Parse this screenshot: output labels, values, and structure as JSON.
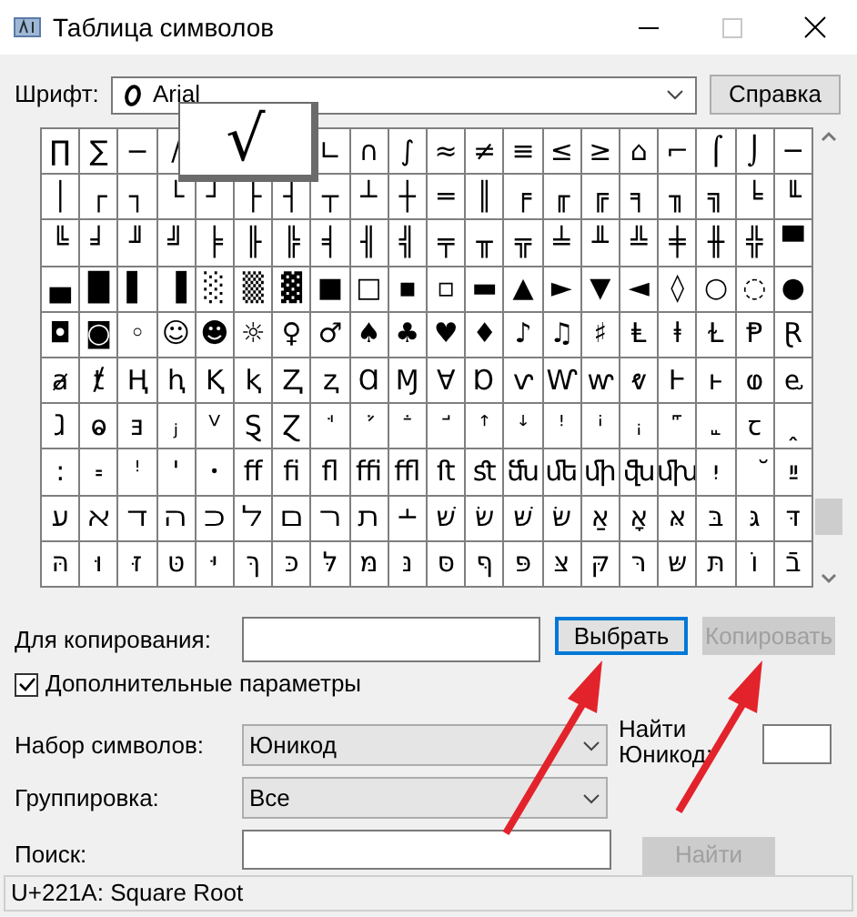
{
  "window": {
    "title": "Таблица символов"
  },
  "font": {
    "label": "Шрифт:",
    "value": "Arial"
  },
  "help_button": {
    "label": "Справка"
  },
  "grid": {
    "magnifier": "√",
    "rows": [
      [
        "∏",
        "∑",
        "−",
        "∕",
        null,
        null,
        null,
        "∟",
        "∩",
        "∫",
        "≈",
        "≠",
        "≡",
        "≤",
        "≥",
        "⌂",
        "⌐",
        "⌠",
        "⌡",
        "─"
      ],
      [
        "│",
        "┌",
        "┐",
        "└",
        "┘",
        "├",
        "┤",
        "┬",
        "┴",
        "┼",
        "═",
        "║",
        "╒",
        "╓",
        "╔",
        "╕",
        "╖",
        "╗",
        "╘",
        "╙"
      ],
      [
        "╚",
        "╛",
        "╜",
        "╝",
        "╞",
        "╟",
        "╠",
        "╡",
        "╢",
        "╣",
        "╤",
        "╥",
        "╦",
        "╧",
        "╨",
        "╩",
        "╪",
        "╫",
        "╬",
        "▀"
      ],
      [
        "▄",
        "█",
        "▌",
        "▐",
        "░",
        "▒",
        "▓",
        "■",
        "□",
        "▪",
        "▫",
        "▬",
        "▲",
        "►",
        "▼",
        "◄",
        "◊",
        "○",
        "◌",
        "●"
      ],
      [
        "◘",
        "◙",
        "◦",
        "☺",
        "☻",
        "☼",
        "♀",
        "♂",
        "♠",
        "♣",
        "♥",
        "♦",
        "♪",
        "♫",
        "♯",
        "Ⱡ",
        "ⱡ",
        "Ɫ",
        "Ᵽ",
        "Ɽ"
      ],
      [
        "ⱥ",
        "ⱦ",
        "Ⱨ",
        "ⱨ",
        "Ⱪ",
        "ⱪ",
        "Ⱬ",
        "ⱬ",
        "Ɑ",
        "Ɱ",
        "Ɐ",
        "Ɒ",
        "ⱱ",
        "Ⱳ",
        "ⱳ",
        "ⱴ",
        "Ⱶ",
        "ⱶ",
        "ⱷ",
        "ⱸ"
      ],
      [
        "ⱹ",
        "ⱺ",
        "ⱻ",
        "ⱼ",
        "ⱽ",
        "Ȿ",
        "Ɀ",
        "ꜗ",
        "ꜘ",
        "ꜙ",
        "ꜚ",
        "ꜛ",
        "ꜜ",
        "ꜝ",
        "ꜞ",
        "ꜟ",
        "꜠",
        "꜡",
        "ꞇ",
        "ꞈ"
      ],
      [
        "꞉",
        "꞊",
        "ꜝ",
        "ꞌ",
        "ꞏ",
        "ﬀ",
        "ﬁ",
        "ﬂ",
        "ﬃ",
        "ﬄ",
        "ﬅ",
        "ﬆ",
        "ﬓ",
        "ﬔ",
        "ﬕ",
        "ﬖ",
        "ﬗ",
        "יִ",
        "ﬞ",
        "ײַ"
      ],
      [
        "ﬠ",
        "ﬡ",
        "ﬢ",
        "ﬣ",
        "ﬤ",
        "ﬥ",
        "ﬦ",
        "ﬧ",
        "ﬨ",
        "﬩",
        "שׁ",
        "שׂ",
        "שּׁ",
        "שּׂ",
        "אַ",
        "אָ",
        "אּ",
        "בּ",
        "גּ",
        "דּ"
      ],
      [
        "הּ",
        "וּ",
        "זּ",
        "טּ",
        "יּ",
        "ךּ",
        "כּ",
        "לּ",
        "מּ",
        "נּ",
        "סּ",
        "ףּ",
        "פּ",
        "צּ",
        "קּ",
        "רּ",
        "שּ",
        "תּ",
        "וֹ",
        "בֿ"
      ]
    ]
  },
  "copy": {
    "label": "Для копирования:"
  },
  "buttons": [
    {
      "label": "Выбрать",
      "disabled": false,
      "focused": true
    },
    {
      "label": "Копировать",
      "disabled": true,
      "focused": false
    }
  ],
  "advanced": {
    "label": "Дополнительные параметры",
    "checked": true
  },
  "charset": {
    "label": "Набор символов:",
    "value": "Юникод"
  },
  "find_unicode": {
    "label": "Найти Юникод:"
  },
  "grouping": {
    "label": "Группировка:",
    "value": "Все"
  },
  "search": {
    "label": "Поиск:",
    "button": {
      "label": "Найти",
      "disabled": true
    }
  },
  "status_bar": "U+221A: Square Root"
}
